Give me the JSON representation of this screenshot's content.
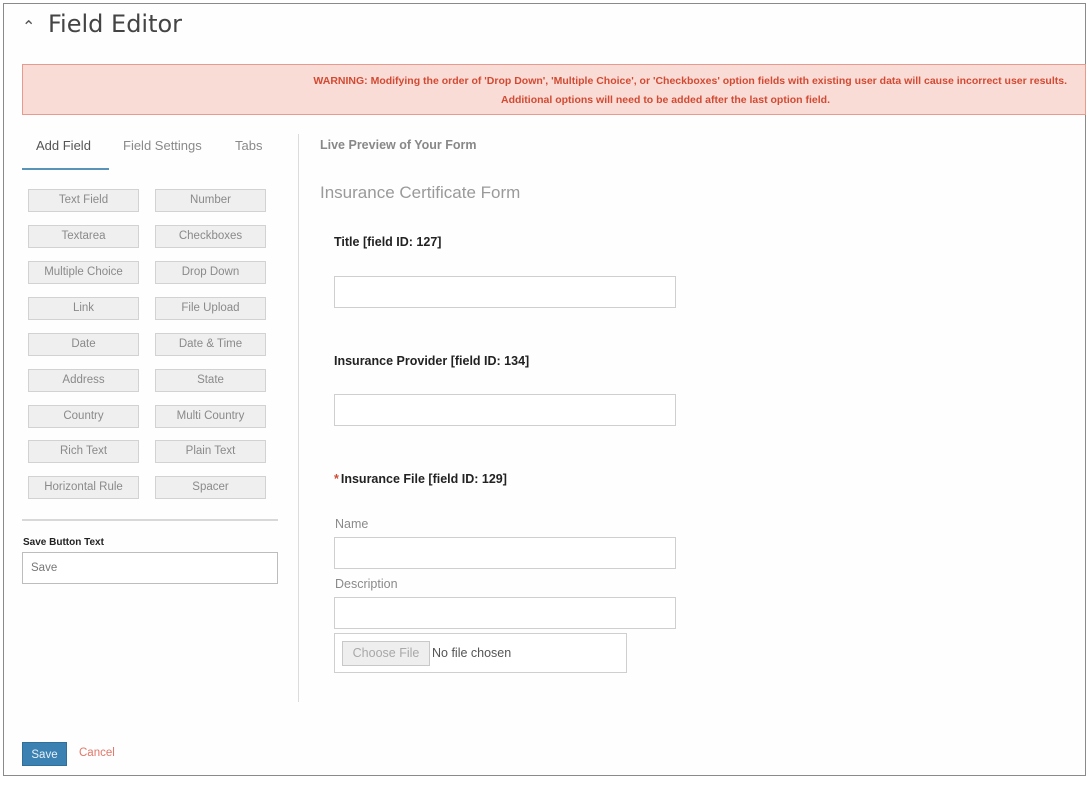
{
  "header": {
    "collapse_icon": "chevron-up-icon",
    "collapse_glyph": "⌃",
    "title": "Field Editor"
  },
  "warning": {
    "line1": "WARNING: Modifying the order of 'Drop Down', 'Multiple Choice', or 'Checkboxes' option fields with existing user data will cause incorrect user results.",
    "line2": "Additional options will need to be added after the last option field."
  },
  "left_tabs": [
    {
      "label": "Add Field",
      "active": true
    },
    {
      "label": "Field Settings",
      "active": false
    },
    {
      "label": "Tabs",
      "active": false
    }
  ],
  "field_types": [
    "Text Field",
    "Number",
    "Textarea",
    "Checkboxes",
    "Multiple Choice",
    "Drop Down",
    "Link",
    "File Upload",
    "Date",
    "Date & Time",
    "Address",
    "State",
    "Country",
    "Multi Country",
    "Rich Text",
    "Plain Text",
    "Horizontal Rule",
    "Spacer"
  ],
  "save_button_text": {
    "label": "Save Button Text",
    "value": "Save"
  },
  "preview": {
    "heading": "Live Preview of Your Form",
    "form_title": "Insurance Certificate Form",
    "fields": [
      {
        "label": "Title [field ID: 127]",
        "required": false
      },
      {
        "label": "Insurance Provider [field ID: 134]",
        "required": false
      },
      {
        "label": "Insurance File [field ID: 129]",
        "required": true,
        "required_mark": "*"
      }
    ],
    "file_subfields": {
      "name_label": "Name",
      "description_label": "Description"
    },
    "file_input": {
      "button": "Choose File",
      "status": "No file chosen"
    }
  },
  "footer": {
    "save": "Save",
    "cancel": "Cancel"
  },
  "colors": {
    "accent": "#3b82b3",
    "warning_bg": "#f9dcd6",
    "warning_text": "#d24a33",
    "cancel": "#e0776a"
  }
}
